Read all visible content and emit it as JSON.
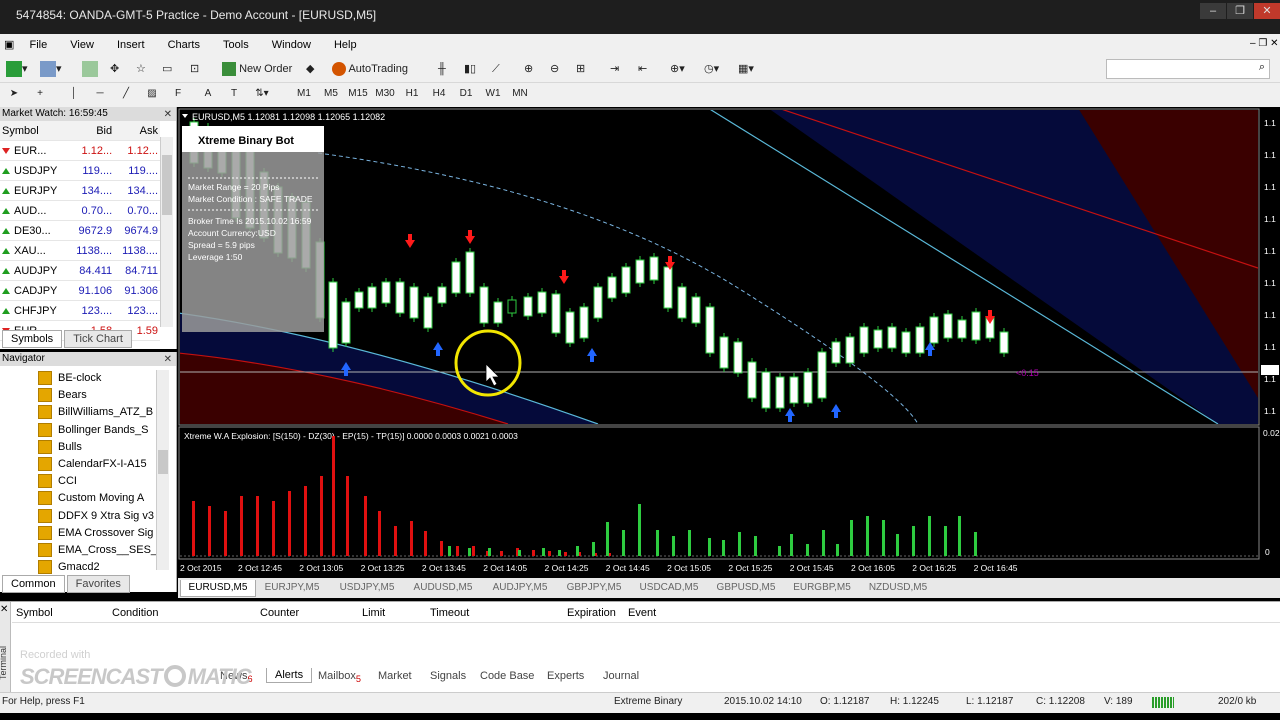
{
  "window": {
    "title": "5474854: OANDA-GMT-5 Practice - Demo Account - [EURUSD,M5]"
  },
  "menu": [
    "File",
    "View",
    "Insert",
    "Charts",
    "Tools",
    "Window",
    "Help"
  ],
  "toolbar": {
    "new_order": "New Order",
    "autotrading": "AutoTrading"
  },
  "timeframes": [
    "M1",
    "M5",
    "M15",
    "M30",
    "H1",
    "H4",
    "D1",
    "W1",
    "MN"
  ],
  "market_watch": {
    "title": "Market Watch: 16:59:45",
    "headers": [
      "Symbol",
      "Bid",
      "Ask"
    ],
    "rows": [
      {
        "symbol": "EUR...",
        "bid": "1.12...",
        "ask": "1.12...",
        "dir": "down"
      },
      {
        "symbol": "USDJPY",
        "bid": "119....",
        "ask": "119....",
        "dir": "up"
      },
      {
        "symbol": "EURJPY",
        "bid": "134....",
        "ask": "134....",
        "dir": "up"
      },
      {
        "symbol": "AUD...",
        "bid": "0.70...",
        "ask": "0.70...",
        "dir": "up"
      },
      {
        "symbol": "DE30...",
        "bid": "9672.9",
        "ask": "9674.9",
        "dir": "up"
      },
      {
        "symbol": "XAU...",
        "bid": "1138....",
        "ask": "1138....",
        "dir": "up"
      },
      {
        "symbol": "AUDJPY",
        "bid": "84.411",
        "ask": "84.711",
        "dir": "up"
      },
      {
        "symbol": "CADJPY",
        "bid": "91.106",
        "ask": "91.306",
        "dir": "up"
      },
      {
        "symbol": "CHFJPY",
        "bid": "123....",
        "ask": "123....",
        "dir": "up"
      },
      {
        "symbol": "EUR",
        "bid": "1.58",
        "ask": "1.59",
        "dir": "down"
      }
    ],
    "tabs": [
      "Symbols",
      "Tick Chart"
    ]
  },
  "navigator": {
    "title": "Navigator",
    "items": [
      "BE-clock",
      "Bears",
      "BillWilliams_ATZ_B",
      "Bollinger Bands_S",
      "Bulls",
      "CalendarFX-I-A15",
      "CCI",
      "Custom Moving A",
      "DDFX 9 Xtra Sig v3",
      "EMA Crossover Sig",
      "EMA_Cross__SES_",
      "Gmacd2"
    ],
    "tabs": [
      "Common",
      "Favorites"
    ]
  },
  "chart": {
    "header": "EURUSD,M5  1.12081 1.12098 1.12065 1.12082",
    "bot": {
      "title": "Xtreme Binary Bot",
      "lines": [
        "Market Range = 20 Pips",
        "Market Condition : SAFE TRADE",
        "Broker Time Is 2015.10.02 16:59",
        "Account Currency:USD",
        "Spread = 5.9 pips",
        "Leverage 1:50"
      ]
    },
    "price_label": "<0.15",
    "price_axis": [
      "1.1",
      "1.1",
      "1.1",
      "1.1",
      "1.1",
      "1.1",
      "1.1",
      "1.1",
      "1.1",
      "1.1"
    ],
    "indicator_label": "Xtreme W.A Explosion: [S(150) - DZ(30) - EP(15) - TP(15)] 0.0000 0.0003 0.0021 0.0003",
    "indicator_axis_top": "0.02",
    "indicator_axis_zero": "0",
    "time_axis": [
      "2 Oct 2015",
      "2 Oct 12:45",
      "2 Oct 13:05",
      "2 Oct 13:25",
      "2 Oct 13:45",
      "2 Oct 14:05",
      "2 Oct 14:25",
      "2 Oct 14:45",
      "2 Oct 15:05",
      "2 Oct 15:25",
      "2 Oct 15:45",
      "2 Oct 16:05",
      "2 Oct 16:25",
      "2 Oct 16:45"
    ]
  },
  "chart_tabs": [
    "EURUSD,M5",
    "EURJPY,M5",
    "USDJPY,M5",
    "AUDUSD,M5",
    "AUDJPY,M5",
    "GBPJPY,M5",
    "USDCAD,M5",
    "GBPUSD,M5",
    "EURGBP,M5",
    "NZDUSD,M5"
  ],
  "terminal": {
    "columns": [
      "Symbol",
      "Condition",
      "Counter",
      "Limit",
      "Timeout",
      "Expiration",
      "Event"
    ],
    "tabs": [
      "News",
      "Alerts",
      "Mailbox",
      "Market",
      "Signals",
      "Code Base",
      "Experts",
      "Journal"
    ],
    "news_count": "6",
    "mailbox_count": "5",
    "side_label": "Terminal"
  },
  "watermark": {
    "line1": "Recorded with",
    "line2": "SCREENCAST",
    "line3": "MATIC"
  },
  "status": {
    "help": "For Help, press F1",
    "profile": "Extreme Binary",
    "datetime": "2015.10.02 14:10",
    "open": "O: 1.12187",
    "high": "H: 1.12245",
    "low": "L: 1.12187",
    "close": "C: 1.12208",
    "volume": "V: 189",
    "traffic": "202/0 kb"
  }
}
